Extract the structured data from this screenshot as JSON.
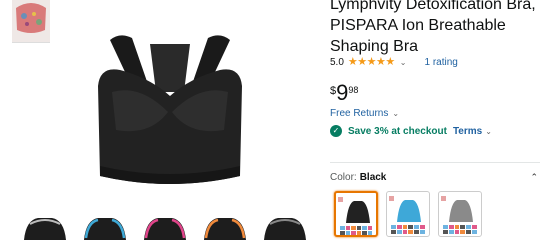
{
  "product": {
    "title": "Lymphvity Detoxification Bra, PISPARA Ion Breathable Shaping Bra",
    "rating_value": "5.0",
    "stars_filled": 5,
    "rating_count": "1 rating",
    "price_symbol": "$",
    "price_whole": "9",
    "price_fraction": "98",
    "free_returns": "Free Returns",
    "coupon_text": "Save 3% at checkout",
    "terms": "Terms",
    "color_label": "Color:",
    "color_value": "Black"
  },
  "colors": {
    "link": "#2162a1",
    "star": "#f59a18",
    "success": "#067d62",
    "selected_border": "#e77600"
  },
  "swatches": [
    {
      "name": "Black",
      "selected": true
    },
    {
      "name": "Blue",
      "selected": false
    },
    {
      "name": "Gray",
      "selected": false
    }
  ],
  "thumbnails": [
    "black-blue-trim",
    "black-blue-trim",
    "black-pink-trim",
    "black-orange-trim",
    "black"
  ]
}
